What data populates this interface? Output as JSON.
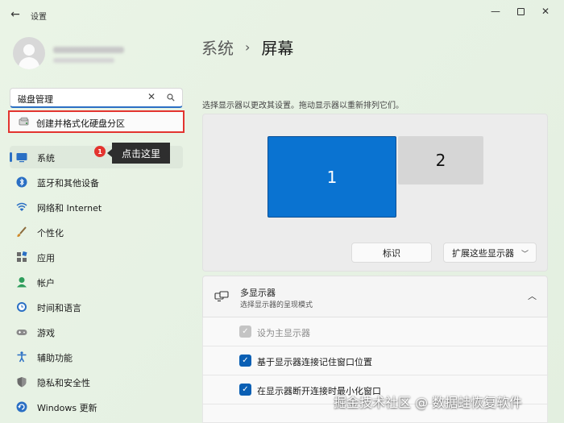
{
  "window": {
    "title": "设置"
  },
  "search": {
    "value": "磁盘管理"
  },
  "dropdown": {
    "result": "创建并格式化硬盘分区"
  },
  "callout": {
    "badge": "1",
    "text": "点击这里"
  },
  "nav": {
    "items": [
      {
        "label": "系统",
        "icon": "system-icon",
        "active": true
      },
      {
        "label": "蓝牙和其他设备",
        "icon": "bluetooth-icon"
      },
      {
        "label": "网络和 Internet",
        "icon": "wifi-icon"
      },
      {
        "label": "个性化",
        "icon": "brush-icon"
      },
      {
        "label": "应用",
        "icon": "apps-icon"
      },
      {
        "label": "帐户",
        "icon": "account-icon"
      },
      {
        "label": "时间和语言",
        "icon": "clock-globe-icon"
      },
      {
        "label": "游戏",
        "icon": "gamepad-icon"
      },
      {
        "label": "辅助功能",
        "icon": "accessibility-icon"
      },
      {
        "label": "隐私和安全性",
        "icon": "shield-icon"
      },
      {
        "label": "Windows 更新",
        "icon": "update-icon"
      }
    ]
  },
  "main": {
    "breadcrumb": {
      "parent": "系统",
      "separator": "›",
      "current": "屏幕"
    },
    "subtitle": "选择显示器以更改其设置。拖动显示器以重新排列它们。",
    "monitors": {
      "primary": "1",
      "secondary": "2"
    },
    "identify_label": "标识",
    "extend_label": "扩展这些显示器",
    "multi_display": {
      "title": "多显示器",
      "subtitle": "选择显示器的呈现模式"
    },
    "options": [
      {
        "label": "设为主显示器",
        "checked": true,
        "disabled": true
      },
      {
        "label": "基于显示器连接记住窗口位置",
        "checked": true,
        "disabled": false
      },
      {
        "label": "在显示器断开连接时最小化窗口",
        "checked": true,
        "disabled": false
      }
    ]
  },
  "watermark": "掘金技术社区 @ 数据蛙恢复软件",
  "colors": {
    "accent": "#0a73d1",
    "highlight": "#e3342f",
    "callout_bg": "#2e2e2e"
  }
}
